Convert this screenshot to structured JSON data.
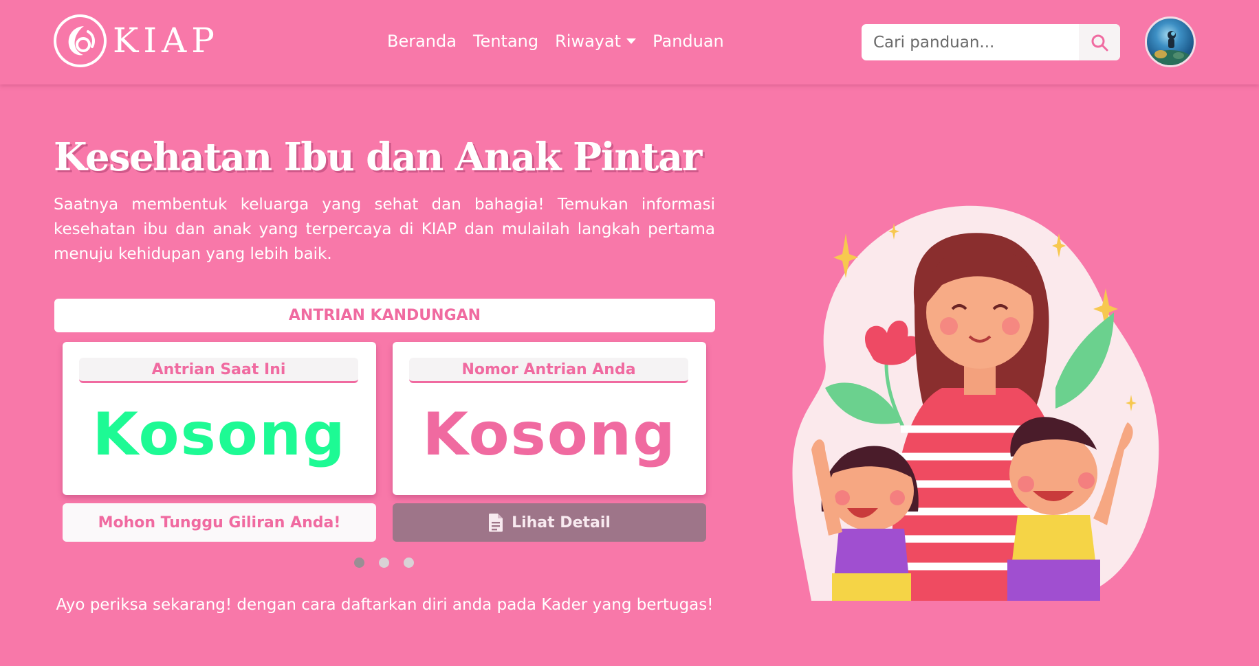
{
  "brand": {
    "name": "KIAP"
  },
  "nav": {
    "items": [
      {
        "label": "Beranda"
      },
      {
        "label": "Tentang"
      },
      {
        "label": "Riwayat"
      },
      {
        "label": "Panduan"
      }
    ]
  },
  "search": {
    "placeholder": "Cari panduan...",
    "icon": "search-icon"
  },
  "hero": {
    "title": "Kesehatan Ibu dan Anak Pintar",
    "description": "Saatnya membentuk keluarga yang sehat dan bahagia! Temukan informasi kesehatan ibu dan anak yang terpercaya di KIAP dan mulailah langkah pertama menuju kehidupan yang lebih baik."
  },
  "queue": {
    "header": "ANTRIAN KANDUNGAN",
    "current": {
      "label": "Antrian Saat Ini",
      "value": "Kosong",
      "color": "#1dfa94"
    },
    "yours": {
      "label": "Nomor Antrian Anda",
      "value": "Kosong",
      "color": "#f06aa0"
    },
    "status": "Mohon Tunggu Giliran Anda!",
    "detail_button": "Lihat Detail",
    "carousel": {
      "total": 3,
      "active": 1
    }
  },
  "footer_note": "Ayo periksa sekarang! dengan cara daftarkan diri anda pada Kader yang bertugas!",
  "colors": {
    "background": "#f878a9",
    "accent": "#f06aa0",
    "detail_button": "#9e7589"
  }
}
